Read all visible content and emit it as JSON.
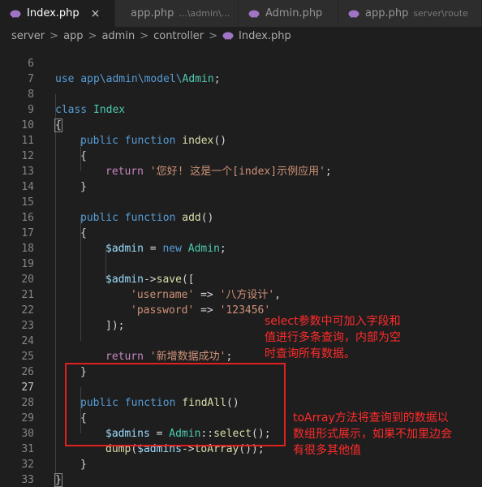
{
  "tabs": [
    {
      "label": "Index.php",
      "hint": "",
      "active": true,
      "close": "×"
    },
    {
      "label": "app.php",
      "hint": "...\\admin\\...",
      "active": false
    },
    {
      "label": "Admin.php",
      "hint": "",
      "active": false
    },
    {
      "label": "app.php",
      "hint": "server\\route",
      "active": false
    }
  ],
  "breadcrumb": [
    "server",
    "app",
    "admin",
    "controller",
    "Index.php"
  ],
  "breadcrumb_sep": ">",
  "line_numbers": [
    "6",
    "7",
    "8",
    "9",
    "10",
    "11",
    "12",
    "13",
    "14",
    "15",
    "16",
    "17",
    "18",
    "19",
    "20",
    "21",
    "22",
    "23",
    "24",
    "25",
    "26",
    "27",
    "28",
    "29",
    "30",
    "31",
    "32",
    "33"
  ],
  "code": {
    "l6": [
      "use app\\admin\\model\\",
      "Admin",
      ";"
    ],
    "l8": [
      "class",
      " ",
      "Index"
    ],
    "l9": [
      "{"
    ],
    "l10": [
      "public",
      " ",
      "function",
      " ",
      "index",
      "()"
    ],
    "l11": [
      "{"
    ],
    "l12": [
      "return",
      " ",
      "'您好! 这是一个[index]示例应用'",
      ";"
    ],
    "l13": [
      "}"
    ],
    "l15": [
      "public",
      " ",
      "function",
      " ",
      "add",
      "()"
    ],
    "l16": [
      "{"
    ],
    "l17": [
      "$admin",
      " = ",
      "new",
      " ",
      "Admin",
      ";"
    ],
    "l19": [
      "$admin",
      "->",
      "save",
      "(["
    ],
    "l20": [
      "'username'",
      " => ",
      "'八方设计'",
      ","
    ],
    "l21": [
      "'password'",
      " => ",
      "'123456'"
    ],
    "l22": [
      "]);"
    ],
    "l24": [
      "return",
      " ",
      "'新增数据成功'",
      ";"
    ],
    "l25": [
      "}"
    ],
    "l27": [
      "public",
      " ",
      "function",
      " ",
      "findAll",
      "()"
    ],
    "l28": [
      "{"
    ],
    "l29": [
      "$admins",
      " = ",
      "Admin",
      "::",
      "select",
      "();"
    ],
    "l30": [
      "dump",
      "(",
      "$admins",
      "->",
      "toArray",
      "());"
    ],
    "l31": [
      "}"
    ],
    "l32": [
      "}"
    ]
  },
  "annotations": {
    "select_note": "select参数中可加入字段和\n值进行多条查询，内部为空\n时查询所有数据。",
    "toarray_note": "toArray方法将查询到的数据以\n数组形式展示，如果不加里边会\n有很多其他值"
  },
  "colors": {
    "background": "#1e1e1e",
    "keyword": "#569cd6",
    "control_keyword": "#c586c0",
    "class": "#4ec9b0",
    "function": "#dcdcaa",
    "variable": "#9cdcfe",
    "string": "#ce9178",
    "annotation": "#ff2b2b",
    "php_icon": "#a074c4"
  }
}
